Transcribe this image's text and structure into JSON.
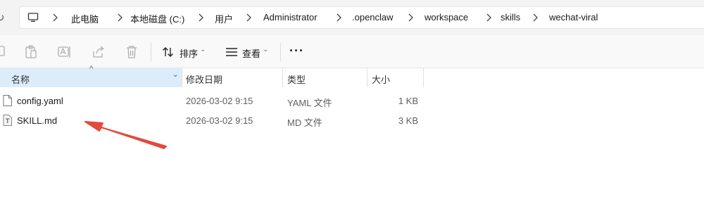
{
  "address_bar": {
    "breadcrumbs": [
      "此电脑",
      "本地磁盘 (C:)",
      "用户",
      "Administrator",
      ".openclaw",
      "workspace",
      "skills",
      "wechat-viral"
    ],
    "separator_icon": "chevron-right-icon",
    "root_icon": "computer-icon"
  },
  "toolbar": {
    "icons": [
      "copy-icon",
      "paste-icon",
      "rename-icon",
      "share-icon",
      "delete-icon"
    ],
    "sort_label": "排序",
    "view_label": "查看",
    "more_label": "···"
  },
  "columns": {
    "name": "名称",
    "date_modified": "修改日期",
    "type": "类型",
    "size": "大小"
  },
  "files": [
    {
      "name": "config.yaml",
      "date": "2026-03-02 9:15",
      "type": "YAML 文件",
      "size": "1 KB",
      "icon": "document-icon"
    },
    {
      "name": "SKILL.md",
      "date": "2026-03-02 9:15",
      "type": "MD 文件",
      "size": "3 KB",
      "icon": "text-document-icon"
    }
  ],
  "colors": {
    "selected_header": "#dcecfb",
    "annotation_arrow": "#e24a3b"
  }
}
